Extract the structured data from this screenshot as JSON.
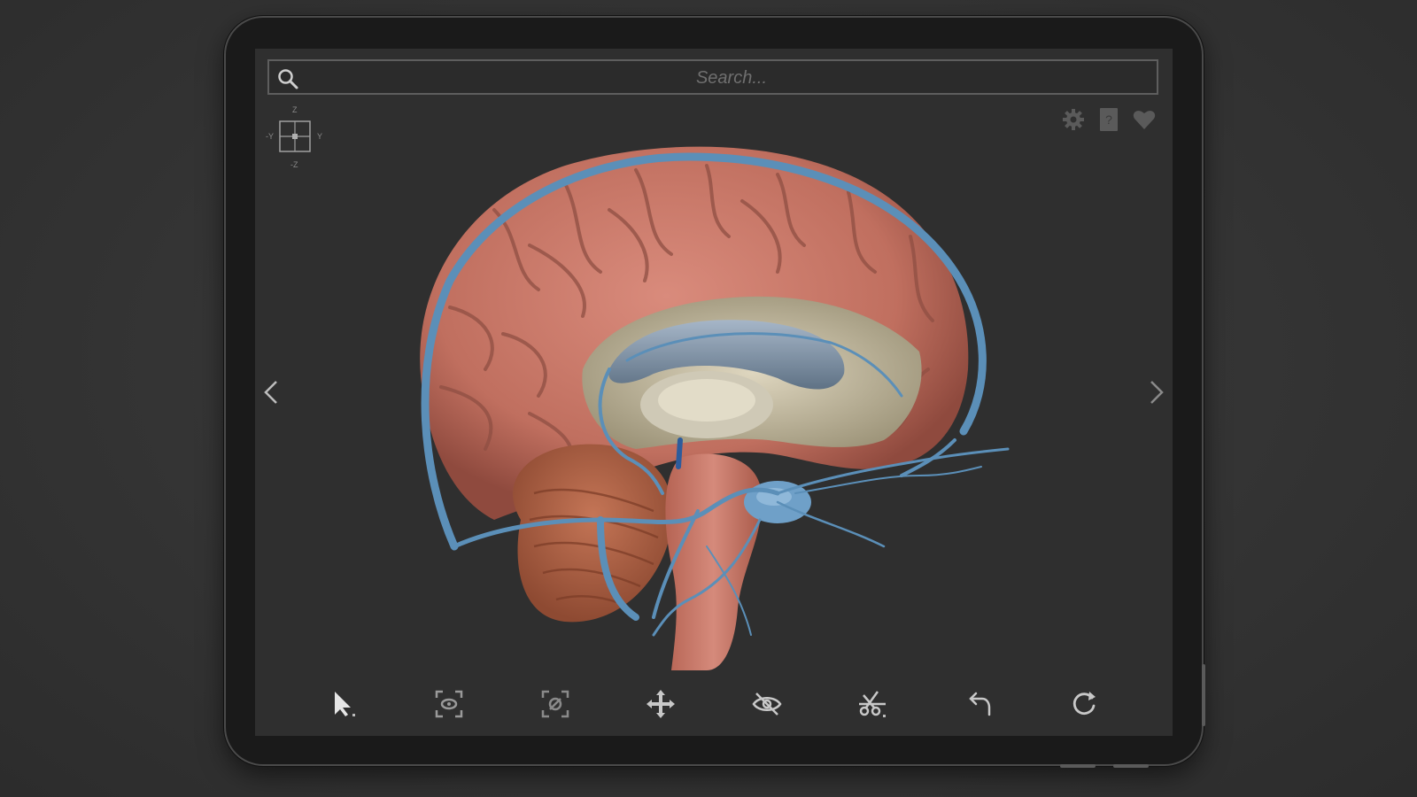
{
  "search": {
    "placeholder": "Search..."
  },
  "axis_gizmo": {
    "top": "Z",
    "bottom": "-Z",
    "left": "-Y",
    "right": "Y"
  },
  "top_icons": [
    "gear-icon",
    "help-icon",
    "heart-icon"
  ],
  "nav": {
    "prev": "chevron-left-icon",
    "next": "chevron-right-icon"
  },
  "toolbar": [
    "select-arrow-icon",
    "isolate-view-icon",
    "focus-view-icon",
    "move-icon",
    "hide-eye-icon",
    "cut-scissors-icon",
    "undo-icon",
    "reset-icon"
  ],
  "colors": {
    "background": "#333333",
    "screen": "#2f2f2f",
    "brain_cortex": "#c9796a",
    "vessels": "#5b8fb8",
    "cerebellum": "#b5654a",
    "ventricle": "#8ea3b8",
    "icons": "#9a9a9a"
  }
}
